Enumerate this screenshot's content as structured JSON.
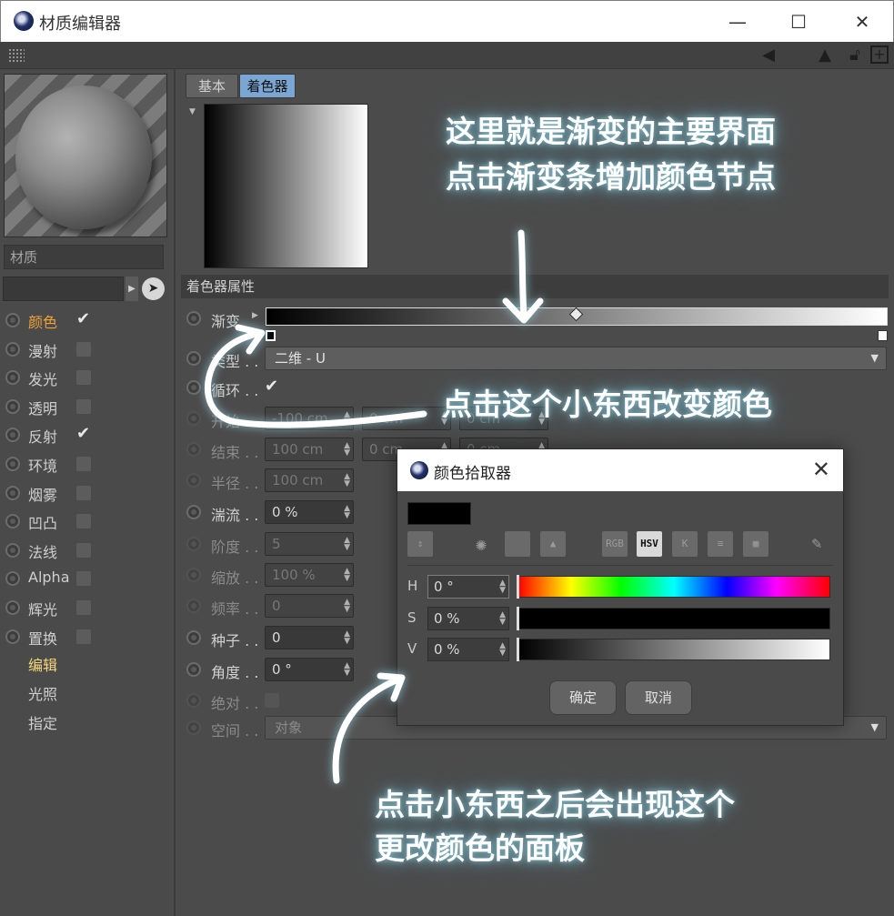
{
  "window": {
    "title": "材质编辑器",
    "buttons": {
      "minimize": "—",
      "maximize": "☐",
      "close": "✕"
    }
  },
  "material": {
    "name": "材质",
    "channels": [
      {
        "label": "颜色",
        "active": true,
        "checked": true
      },
      {
        "label": "漫射",
        "active": false,
        "checked": false
      },
      {
        "label": "发光",
        "active": false,
        "checked": false
      },
      {
        "label": "透明",
        "active": false,
        "checked": false
      },
      {
        "label": "反射",
        "active": false,
        "checked": true
      },
      {
        "label": "环境",
        "active": false,
        "checked": false
      },
      {
        "label": "烟雾",
        "active": false,
        "checked": false
      },
      {
        "label": "凹凸",
        "active": false,
        "checked": false
      },
      {
        "label": "法线",
        "active": false,
        "checked": false
      },
      {
        "label": "Alpha",
        "active": false,
        "checked": false
      },
      {
        "label": "辉光",
        "active": false,
        "checked": false
      },
      {
        "label": "置换",
        "active": false,
        "checked": false
      }
    ],
    "sub_items": [
      "编辑",
      "光照",
      "指定"
    ]
  },
  "tabs": {
    "basic": "基本",
    "shader": "着色器"
  },
  "shader": {
    "section_title": "着色器属性",
    "gradient_label": "渐变",
    "type_label": "类型",
    "type_value": "二维 - U",
    "cycle_label": "循环",
    "start_label": "开始",
    "start_values": [
      "-100 cm",
      "0 cm",
      "0 cm"
    ],
    "end_label": "结束",
    "end_values": [
      "100 cm",
      "0 cm",
      "0 cm"
    ],
    "radius_label": "半径",
    "radius_value": "100 cm",
    "turbulence_label": "湍流",
    "turbulence_value": "0 %",
    "octaves_label": "阶度",
    "octaves_value": "5",
    "scale_label": "缩放",
    "scale_value": "100 %",
    "frequency_label": "频率",
    "frequency_value": "0",
    "seed_label": "种子",
    "seed_value": "0",
    "angle_label": "角度",
    "angle_value": "0 °",
    "absolute_label": "绝对",
    "space_label": "空间",
    "space_value": "对象",
    "label_ellipsis": ". ."
  },
  "color_picker": {
    "title": "颜色拾取器",
    "close": "✕",
    "modes": [
      "RGB",
      "HSV",
      "K"
    ],
    "active_mode": "HSV",
    "h_label": "H",
    "h_value": "0 °",
    "s_label": "S",
    "s_value": "0 %",
    "v_label": "V",
    "v_value": "0 %",
    "ok": "确定",
    "cancel": "取消",
    "current_color": "#000000"
  },
  "annotations": {
    "top_line1": "这里就是渐变的主要界面",
    "top_line2": "点击渐变条增加颜色节点",
    "middle": "点击这个小东西改变颜色",
    "bottom_line1": "点击小东西之后会出现这个",
    "bottom_line2": "更改颜色的面板"
  },
  "colors": {
    "panel_bg": "#4b4b4b",
    "active_channel": "#f0a13a",
    "active_tab": "#7ba6d4"
  }
}
